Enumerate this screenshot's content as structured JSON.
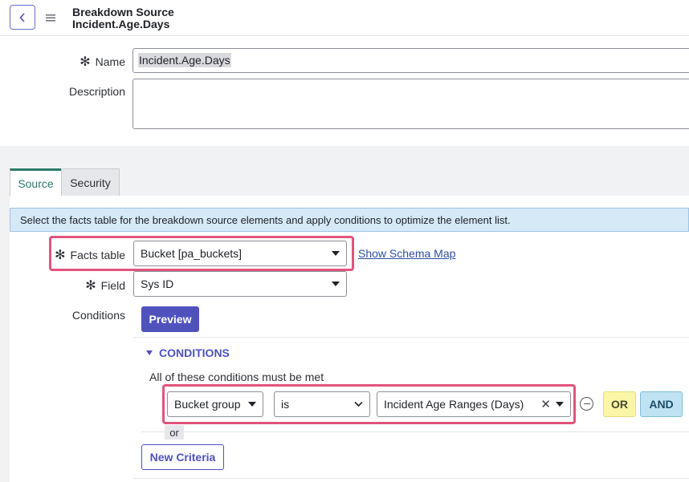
{
  "header": {
    "title_line1": "Breakdown Source",
    "title_line2": "Incident.Age.Days"
  },
  "form": {
    "name_label": "Name",
    "name_value": "Incident.Age.Days",
    "description_label": "Description",
    "description_value": "",
    "required_marker": "✻"
  },
  "tabs": [
    {
      "label": "Source",
      "active": true
    },
    {
      "label": "Security",
      "active": false
    }
  ],
  "source": {
    "info_banner": "Select the facts table for the breakdown source elements and apply conditions to optimize the element list.",
    "facts_table_label": "Facts table",
    "facts_table_value": "Bucket [pa_buckets]",
    "show_schema_map": "Show Schema Map",
    "field_label": "Field",
    "field_value": "Sys ID",
    "conditions_label": "Conditions",
    "preview_button": "Preview"
  },
  "conditions": {
    "header": "CONDITIONS",
    "note": "All of these conditions must be met",
    "row": {
      "field": "Bucket group",
      "operator": "is",
      "value": "Incident Age Ranges (Days)",
      "clear_glyph": "✕"
    },
    "or_button": "OR",
    "and_button": "AND",
    "or_separator": "or",
    "new_criteria_button": "New Criteria"
  },
  "colors": {
    "accent": "#4f52bd",
    "highlight": "#e2547d",
    "tab_active": "#2b7a6a",
    "or_bg": "#fbf6a6",
    "and_bg": "#bfe3f2",
    "banner_bg": "#d6e9f7"
  },
  "icons": {
    "back": "chevron-left-icon",
    "menu": "hamburger-menu-icon",
    "dropdown": "caret-down-icon",
    "remove": "minus-circle-icon",
    "collapse": "triangle-down-icon"
  }
}
